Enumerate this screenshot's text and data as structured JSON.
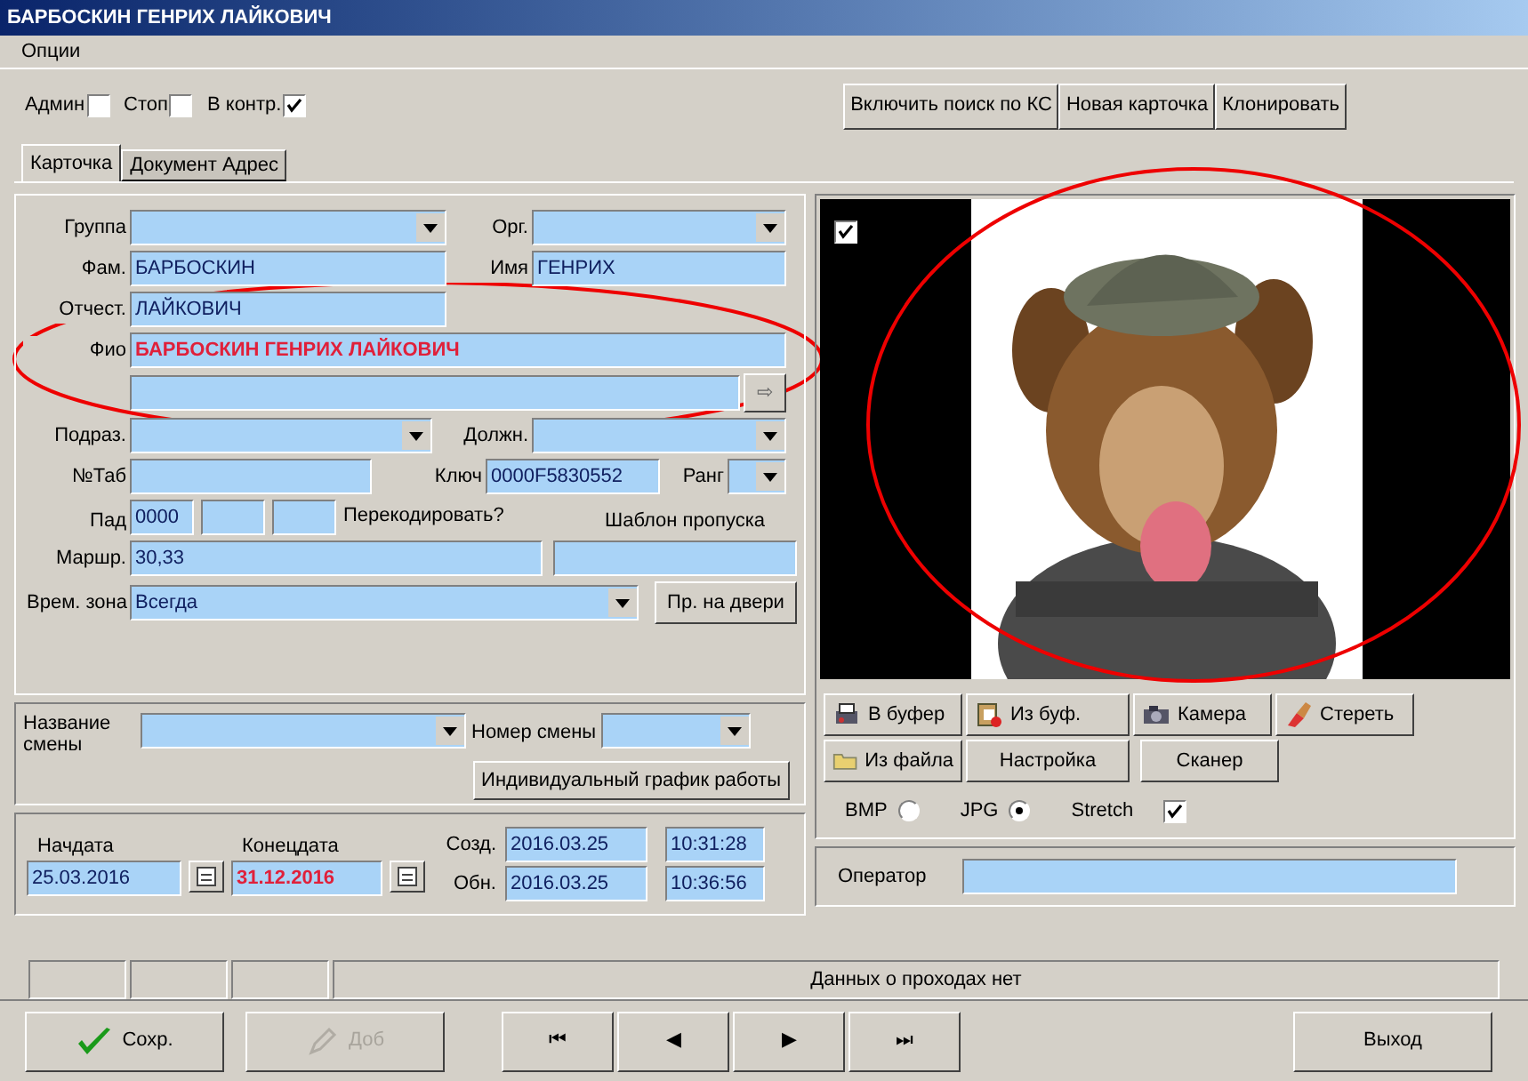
{
  "window": {
    "title": "БАРБОСКИН ГЕНРИХ ЛАЙКОВИЧ"
  },
  "menu": [
    "Опции"
  ],
  "flags": [
    {
      "label": "Админ",
      "checked": false
    },
    {
      "label": "Стоп",
      "checked": false
    },
    {
      "label": "В контр.",
      "checked": true
    }
  ],
  "toolbar_buttons": [
    "Включить поиск по КС",
    "Новая карточка",
    "Клонировать"
  ],
  "tabs": [
    {
      "label": "Карточка",
      "selected": true
    },
    {
      "label": "Документ Адрес",
      "selected": false
    }
  ],
  "card": {
    "group": {
      "label": "Группа"
    },
    "org": {
      "label": "Орг."
    },
    "surname": {
      "label": "Фам.",
      "value": "БАРБОСКИН"
    },
    "name": {
      "label": "Имя",
      "value": "ГЕНРИХ"
    },
    "patronymic": {
      "label": "Отчест.",
      "value": "ЛАЙКОВИЧ"
    },
    "full_name": {
      "label": "Фио",
      "value": "БАРБОСКИН ГЕНРИХ ЛАЙКОВИЧ"
    },
    "arrow_button": "⇨",
    "department": {
      "label": "Подраз."
    },
    "position": {
      "label": "Должн."
    },
    "tab_number": {
      "label": "№Таб"
    },
    "key": {
      "label": "Ключ",
      "value": "0000F5830552"
    },
    "rank": {
      "label": "Ранг"
    },
    "pad": {
      "label": "Пад",
      "value": "0000"
    },
    "recode": "Перекодировать?",
    "pass_template": {
      "label": "Шаблон пропуска"
    },
    "route": {
      "label": "Маршр.",
      "value": "30,33"
    },
    "time_zone": {
      "label": "Врем. зона",
      "value": "Всегда"
    },
    "door_button": "Пр. на двери"
  },
  "shift": {
    "name_label": "Название смены",
    "number_label": "Номер смены",
    "schedule_button": "Индивидуальный график работы"
  },
  "dates": {
    "start": {
      "label": "Начдата",
      "value": "25.03.2016"
    },
    "end": {
      "label": "Конецдата",
      "value": "31.12.2016"
    },
    "created": {
      "label": "Созд.",
      "date": "2016.03.25",
      "time": "10:31:28"
    },
    "updated": {
      "label": "Обн.",
      "date": "2016.03.25",
      "time": "10:36:56"
    }
  },
  "photo": {
    "checked": true,
    "buttons": [
      {
        "label": "В буфер",
        "kind": "copy"
      },
      {
        "label": "Из буф.",
        "kind": "paste"
      },
      {
        "label": "Камера",
        "kind": "camera"
      },
      {
        "label": "Стереть",
        "kind": "erase"
      },
      {
        "label": "Из файла",
        "kind": "file"
      },
      {
        "label": "Настройка",
        "kind": "plain"
      },
      {
        "label": "Сканер",
        "kind": "plain"
      }
    ],
    "formats": [
      {
        "label": "BMP",
        "selected": false
      },
      {
        "label": "JPG",
        "selected": true
      }
    ],
    "stretch": {
      "label": "Stretch",
      "checked": true
    }
  },
  "operator": {
    "label": "Оператор"
  },
  "status_bar": {
    "message": "Данных о проходах нет"
  },
  "bottom_buttons": [
    {
      "label": "Сохр.",
      "kind": "save",
      "disabled": false
    },
    {
      "label": "Доб",
      "kind": "add",
      "disabled": true
    },
    {
      "label": "⏮",
      "kind": "nav",
      "disabled": false
    },
    {
      "label": "◀",
      "kind": "nav",
      "disabled": false
    },
    {
      "label": "▶",
      "kind": "nav",
      "disabled": false
    },
    {
      "label": "⏭",
      "kind": "nav",
      "disabled": false
    },
    {
      "label": "Выход",
      "kind": "exit",
      "disabled": false
    }
  ]
}
